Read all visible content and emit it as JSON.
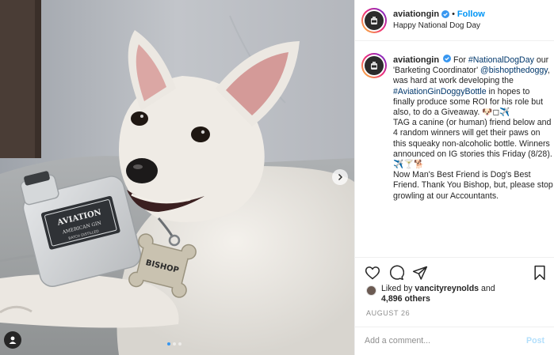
{
  "post": {
    "username": "aviationgin",
    "follow_label": "Follow",
    "separator": "•",
    "location": "Happy National Dog Day",
    "caption": {
      "username": "aviationgin",
      "lead": "For ",
      "hashtag_1": "#NationalDogDay",
      "part_2": " our 'Barketing Coordinator' ",
      "mention": "@bishopthedoggy",
      "part_3": ", was hard at work developing the ",
      "hashtag_2": "#AviationGinDoggyBottle",
      "part_4": " in hopes to finally produce some ROI for his role but also, to do a Giveaway. 🐶◻✈️\nTAG a canine (or human) friend below and 4 random winners will get their paws on this squeaky non-alcoholic bottle. Winners announced on IG stories this Friday (8/28).\n✈️🍸🐕\nNow Man's Best Friend is Dog's Best Friend. Thank You Bishop, but, please stop growling at our Accountants."
    },
    "likes": {
      "prefix": "Liked by ",
      "user": "vancityreynolds",
      "middle": " and",
      "count": "4,896 others"
    },
    "date": "AUGUST 26",
    "comment_placeholder": "Add a comment...",
    "post_label": "Post",
    "photo": {
      "bottle_brand": "AVIATION",
      "bottle_sub": "AMERICAN GIN",
      "bottle_small": "BATCH DISTILLED",
      "tag_name": "BISHOP"
    }
  },
  "colors": {
    "accent": "#0095f6",
    "link": "#00376b",
    "muted": "#8e8e8e",
    "border": "#efefef"
  },
  "icons": [
    "verified-badge-icon",
    "heart-icon",
    "comment-icon",
    "share-icon",
    "bookmark-icon",
    "chevron-right-icon",
    "user-tag-icon"
  ],
  "carousel": {
    "count": 3,
    "active": 1
  }
}
